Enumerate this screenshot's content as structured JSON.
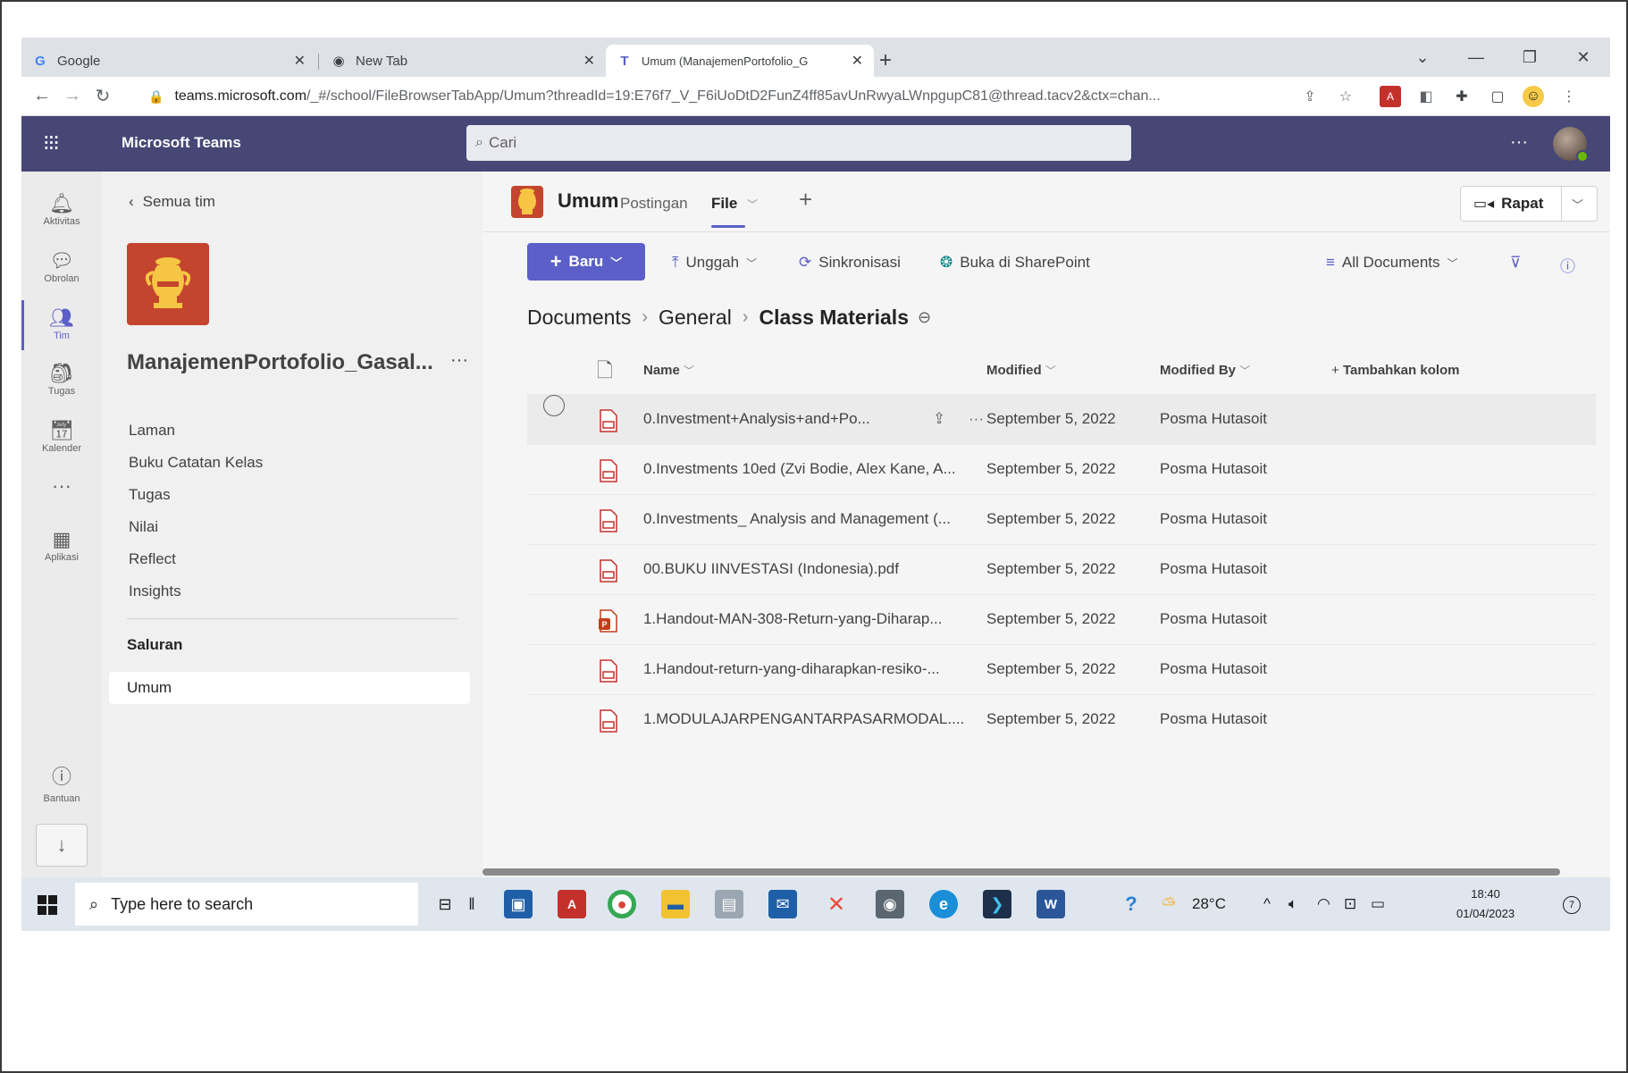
{
  "browser": {
    "tabs": [
      {
        "label": "Google",
        "icon": "google-icon"
      },
      {
        "label": "New Tab",
        "icon": "globe-icon"
      },
      {
        "label": "Umum (ManajemenPortofolio_G",
        "icon": "teams-icon"
      }
    ],
    "url_host": "teams.microsoft.com",
    "url_path": "/_#/school/FileBrowserTabApp/Umum?threadId=19:E76f7_V_F6iUoDtD2FunZ4ff85avUnRwyaLWnpgupC81@thread.tacv2&ctx=chan..."
  },
  "teams": {
    "app_name": "Microsoft Teams",
    "search_placeholder": "Cari",
    "more": "···"
  },
  "rail": [
    {
      "label": "Aktivitas",
      "icon": "bell-icon"
    },
    {
      "label": "Obrolan",
      "icon": "chat-icon"
    },
    {
      "label": "Tim",
      "icon": "teams-people-icon"
    },
    {
      "label": "Tugas",
      "icon": "backpack-icon"
    },
    {
      "label": "Kalender",
      "icon": "calendar-icon"
    },
    {
      "label": "···",
      "icon": "more-icon"
    },
    {
      "label": "Aplikasi",
      "icon": "apps-icon"
    }
  ],
  "help_label": "Bantuan",
  "left": {
    "back_label": "Semua tim",
    "team_name": "ManajemenPortofolio_Gasal...",
    "team_more": "···",
    "nav": [
      "Laman",
      "Buku Catatan Kelas",
      "Tugas",
      "Nilai",
      "Reflect",
      "Insights"
    ],
    "channels_heading": "Saluran",
    "channel": "Umum"
  },
  "channel_header": {
    "name": "Umum",
    "tabs": [
      "Postingan",
      "File"
    ],
    "meet_label": "Rapat"
  },
  "commands": {
    "new": "Baru",
    "upload": "Unggah",
    "sync": "Sinkronisasi",
    "open_sharepoint": "Buka di SharePoint",
    "view": "All Documents"
  },
  "breadcrumb": [
    "Documents",
    "General",
    "Class Materials"
  ],
  "table": {
    "headers": {
      "name": "Name",
      "modified": "Modified",
      "modified_by": "Modified By",
      "add_column": "Tambahkan kolom"
    },
    "rows": [
      {
        "name": "0.Investment+Analysis+and+Po...",
        "modified": "September 5, 2022",
        "by": "Posma Hutasoit",
        "type": "pdf"
      },
      {
        "name": "0.Investments 10ed (Zvi Bodie, Alex Kane, A...",
        "modified": "September 5, 2022",
        "by": "Posma Hutasoit",
        "type": "pdf"
      },
      {
        "name": "0.Investments_ Analysis and Management (...",
        "modified": "September 5, 2022",
        "by": "Posma Hutasoit",
        "type": "pdf"
      },
      {
        "name": "00.BUKU IINVESTASI (Indonesia).pdf",
        "modified": "September 5, 2022",
        "by": "Posma Hutasoit",
        "type": "pdf"
      },
      {
        "name": "1.Handout-MAN-308-Return-yang-Diharap...",
        "modified": "September 5, 2022",
        "by": "Posma Hutasoit",
        "type": "pptx"
      },
      {
        "name": "1.Handout-return-yang-diharapkan-resiko-...",
        "modified": "September 5, 2022",
        "by": "Posma Hutasoit",
        "type": "pdf"
      },
      {
        "name": "1.MODULAJARPENGANTARPASARMODAL....",
        "modified": "September 5, 2022",
        "by": "Posma Hutasoit",
        "type": "pdf"
      }
    ]
  },
  "taskbar": {
    "search_placeholder": "Type here to search",
    "temperature": "28°C",
    "time": "18:40",
    "date": "01/04/2023",
    "notifications": "7"
  },
  "colors": {
    "teams_purple": "#464775",
    "accent": "#5b5fc7",
    "team_logo": "#c4452d",
    "pdf_red": "#c4312b",
    "ppt_red": "#c43e1c"
  }
}
